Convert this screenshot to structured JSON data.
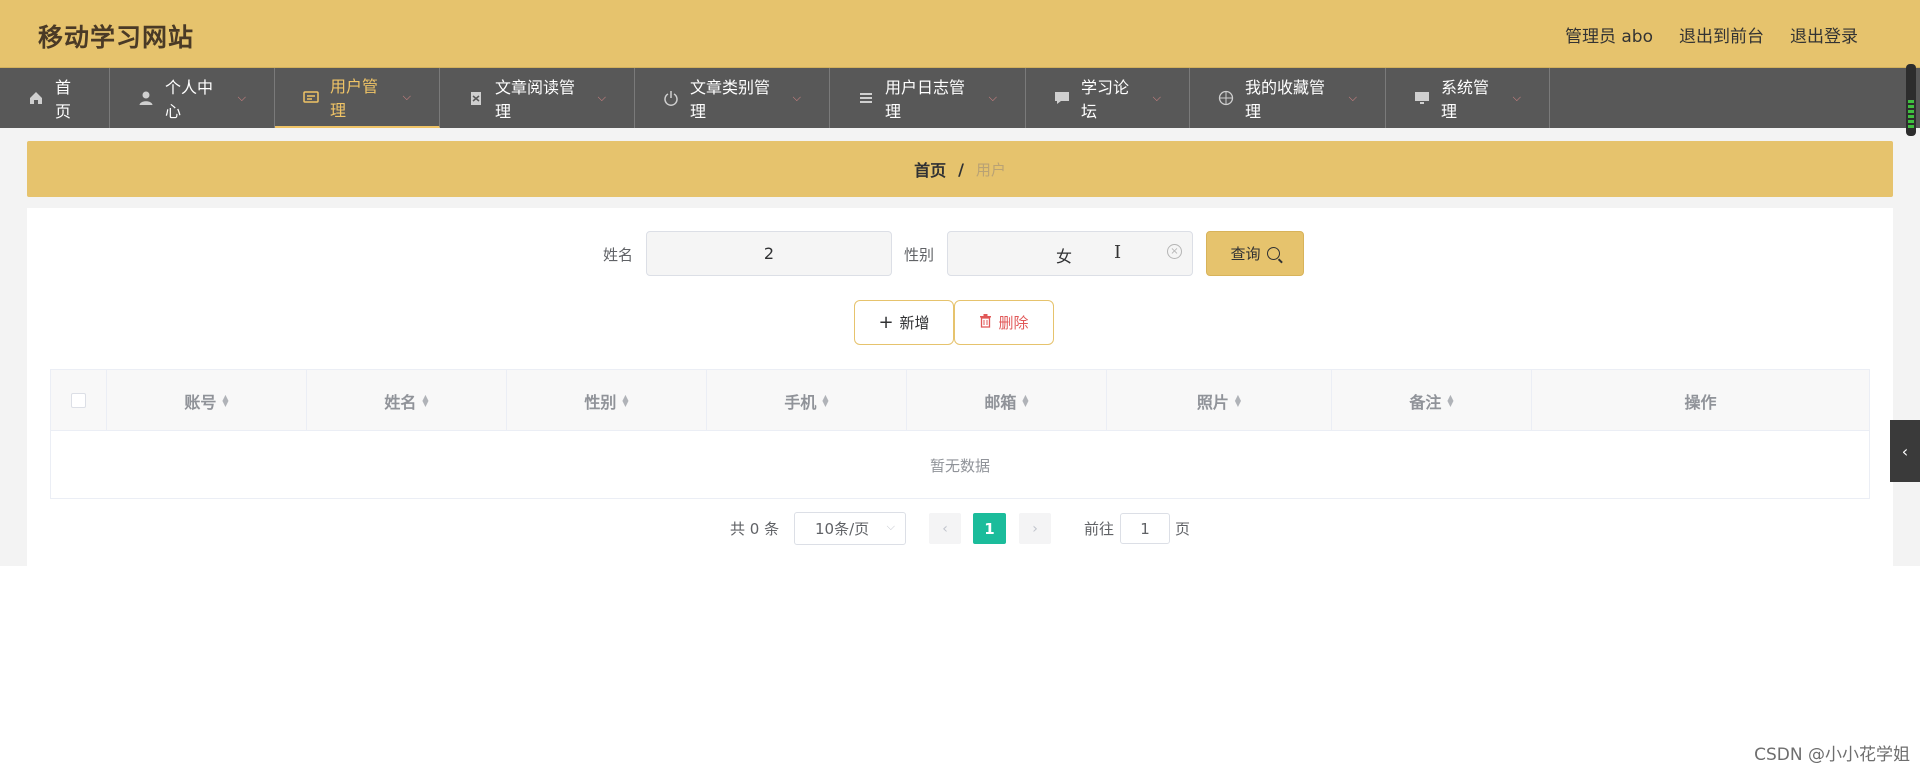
{
  "header": {
    "brand": "移动学习网站",
    "user": "管理员 abo",
    "to_front": "退出到前台",
    "logout": "退出登录"
  },
  "nav": [
    {
      "label": "首页",
      "icon": "home-icon"
    },
    {
      "label": "个人中心",
      "icon": "user-icon"
    },
    {
      "label": "用户管理",
      "icon": "id-card-icon",
      "active": true
    },
    {
      "label": "文章阅读管理",
      "icon": "document-icon"
    },
    {
      "label": "文章类别管理",
      "icon": "power-icon"
    },
    {
      "label": "用户日志管理",
      "icon": "list-icon"
    },
    {
      "label": "学习论坛",
      "icon": "chat-icon"
    },
    {
      "label": "我的收藏管理",
      "icon": "compass-icon"
    },
    {
      "label": "系统管理",
      "icon": "monitor-icon"
    }
  ],
  "breadcrumb": {
    "home": "首页",
    "sep": "/",
    "current": "用户"
  },
  "search": {
    "name_label": "姓名",
    "name_value": "2",
    "gender_label": "性别",
    "gender_value": "女",
    "query_label": "查询"
  },
  "actions": {
    "add_label": "新增",
    "delete_label": "删除"
  },
  "table": {
    "columns": [
      "账号",
      "姓名",
      "性别",
      "手机",
      "邮箱",
      "照片",
      "备注",
      "操作"
    ],
    "empty_text": "暂无数据"
  },
  "pagination": {
    "total": "共 0 条",
    "page_size": "10条/页",
    "current_page": "1",
    "goto_label": "前往",
    "goto_value": "1",
    "page_suffix": "页"
  },
  "watermark": "CSDN @小小花学姐",
  "colors": {
    "header": "#e6c36d",
    "nav": "#585858",
    "active": "#f0c466",
    "page_active": "#1bbc9b"
  }
}
